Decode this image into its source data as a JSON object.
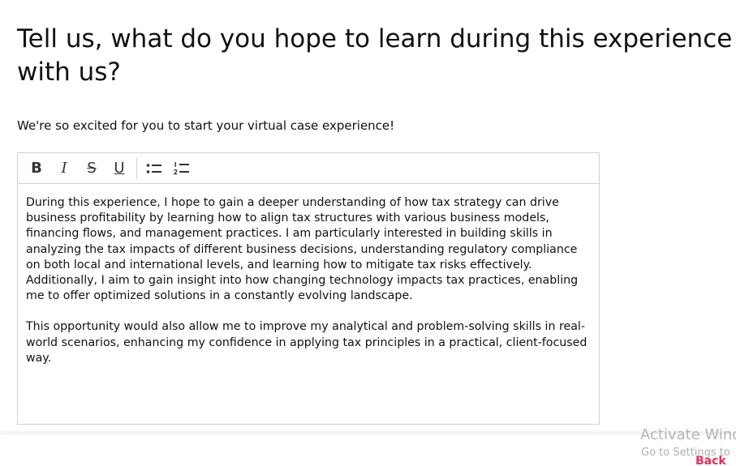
{
  "question": {
    "title_line1": "Tell us, what do you hope to learn during this experience",
    "title_line2": "with us?",
    "subtitle": "We're so excited for you to start your virtual case experience!"
  },
  "toolbar": {
    "bold": "B",
    "italic": "I",
    "strikethrough": "S",
    "underline": "U",
    "bulleted_list": "bulleted-list-icon",
    "numbered_list": "numbered-list-icon"
  },
  "editor": {
    "paragraphs": [
      "During this experience, I hope to gain a deeper understanding of how tax strategy can drive business profitability by learning how to align tax structures with various business models, financing flows, and management practices. I am particularly interested in building skills in analyzing the tax impacts of different business decisions, understanding regulatory compliance on both local and international levels, and learning how to mitigate tax risks effectively. Additionally, I aim to gain insight into how changing technology impacts tax practices, enabling me to offer optimized solutions in a constantly evolving landscape.",
      "This opportunity would also allow me to improve my analytical and problem-solving skills in real-world scenarios, enhancing my confidence in applying tax principles in a practical, client-focused way."
    ]
  },
  "footer": {
    "back_label": "Back",
    "back_color": "#e0315b"
  },
  "os_watermark": {
    "line1": "Activate Windows",
    "line2": "Go to Settings to"
  }
}
